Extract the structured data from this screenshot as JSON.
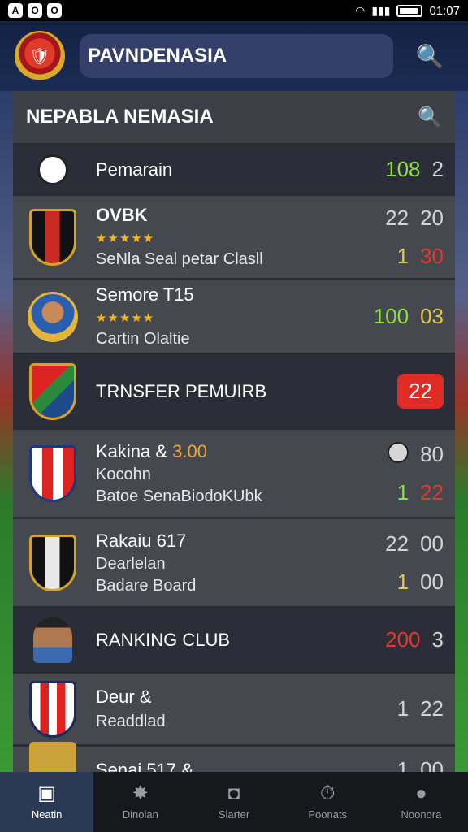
{
  "status": {
    "left_icons": [
      "A",
      "O",
      "O"
    ],
    "time": "01:07"
  },
  "header": {
    "search_text": "PAVNDENASIA",
    "logo_icon": "club-crest-icon",
    "search_icon": "search-icon"
  },
  "panel": {
    "title": "NEPABLA NEMASIA"
  },
  "rows": [
    {
      "main": "Pemarain",
      "stat1": "108",
      "stat2": "2"
    },
    {
      "main": "OVBK",
      "stars": "★★★★★",
      "sub": "SeNla Seal petar Clasll",
      "stat_a1": "22",
      "stat_a2": "20",
      "stat_b1": "1",
      "stat_b2": "30"
    },
    {
      "main": "Semore T15",
      "stars": "★★★★★",
      "sub": "Cartin Olaltie",
      "stat1": "100",
      "stat2": "03"
    },
    {
      "main": "TRNSFER PEMUIRB",
      "badge": "22"
    },
    {
      "main": "Kakina & ",
      "main_accent": "3.00",
      "sub1": "Kocohn",
      "sub2": "Batoe SenaBiodoKUbk",
      "stat_a2": "80",
      "stat_b1": "1",
      "stat_b2": "22"
    },
    {
      "main": "Rakaiu 617",
      "sub1": "Dearlelan",
      "sub2": "Badare Board",
      "stat_a1": "22",
      "stat_a2": "00",
      "stat_b1": "1",
      "stat_b2": "00"
    },
    {
      "main": "RANKING CLUB",
      "stat1": "200",
      "stat2": "3"
    },
    {
      "main": "Deur &",
      "sub": "Readdlad",
      "stat1": "1",
      "stat2": "22"
    },
    {
      "main": "Senai 517 &",
      "stat1": "1",
      "stat2": "00"
    }
  ],
  "nav": [
    {
      "label": "Neatin",
      "icon": "home-icon"
    },
    {
      "label": "Dinoian",
      "icon": "star-badge-icon"
    },
    {
      "label": "Slarter",
      "icon": "clock-icon"
    },
    {
      "label": "Poonats",
      "icon": "stopwatch-icon"
    },
    {
      "label": "Noonora",
      "icon": "user-icon"
    }
  ],
  "colors": {
    "header_bg": "#142244",
    "row_bg": "#45484e",
    "highlight_green": "#8be03a",
    "highlight_red": "#e5382c",
    "gold": "#f1b51e"
  }
}
